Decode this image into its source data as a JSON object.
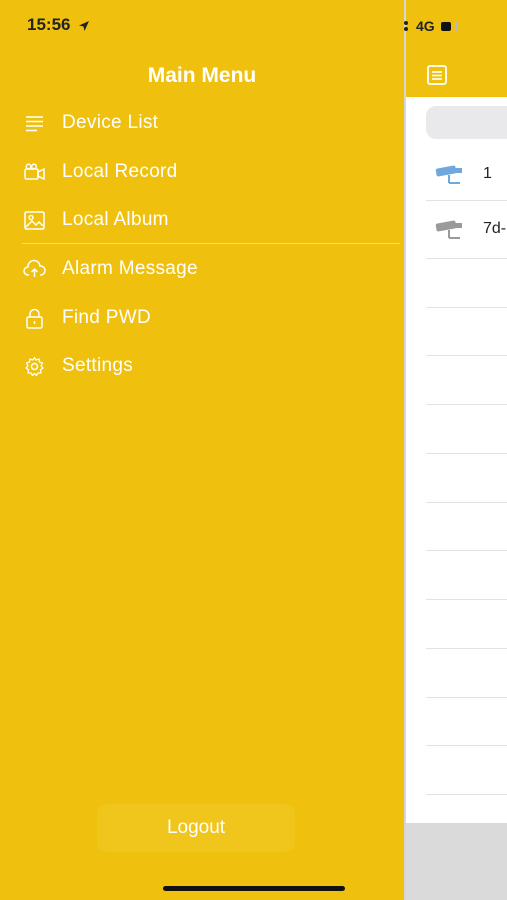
{
  "status_bar": {
    "time": "15:56",
    "network": "4G"
  },
  "drawer": {
    "title": "Main Menu",
    "items": [
      {
        "label": "Device List",
        "icon": "list-icon"
      },
      {
        "label": "Local Record",
        "icon": "video-camera-icon"
      },
      {
        "label": "Local Album",
        "icon": "image-icon"
      },
      {
        "label": "Alarm Message",
        "icon": "cloud-upload-icon"
      },
      {
        "label": "Find PWD",
        "icon": "lock-icon"
      },
      {
        "label": "Settings",
        "icon": "gear-icon"
      }
    ],
    "logout_label": "Logout"
  },
  "device_panel": {
    "devices": [
      {
        "name": "1",
        "online": true
      },
      {
        "name": "7d-",
        "online": false
      }
    ]
  },
  "colors": {
    "drawer_bg": "#EFC10E",
    "camera_online": "#6FA8DC",
    "camera_offline": "#9a9a9a"
  }
}
